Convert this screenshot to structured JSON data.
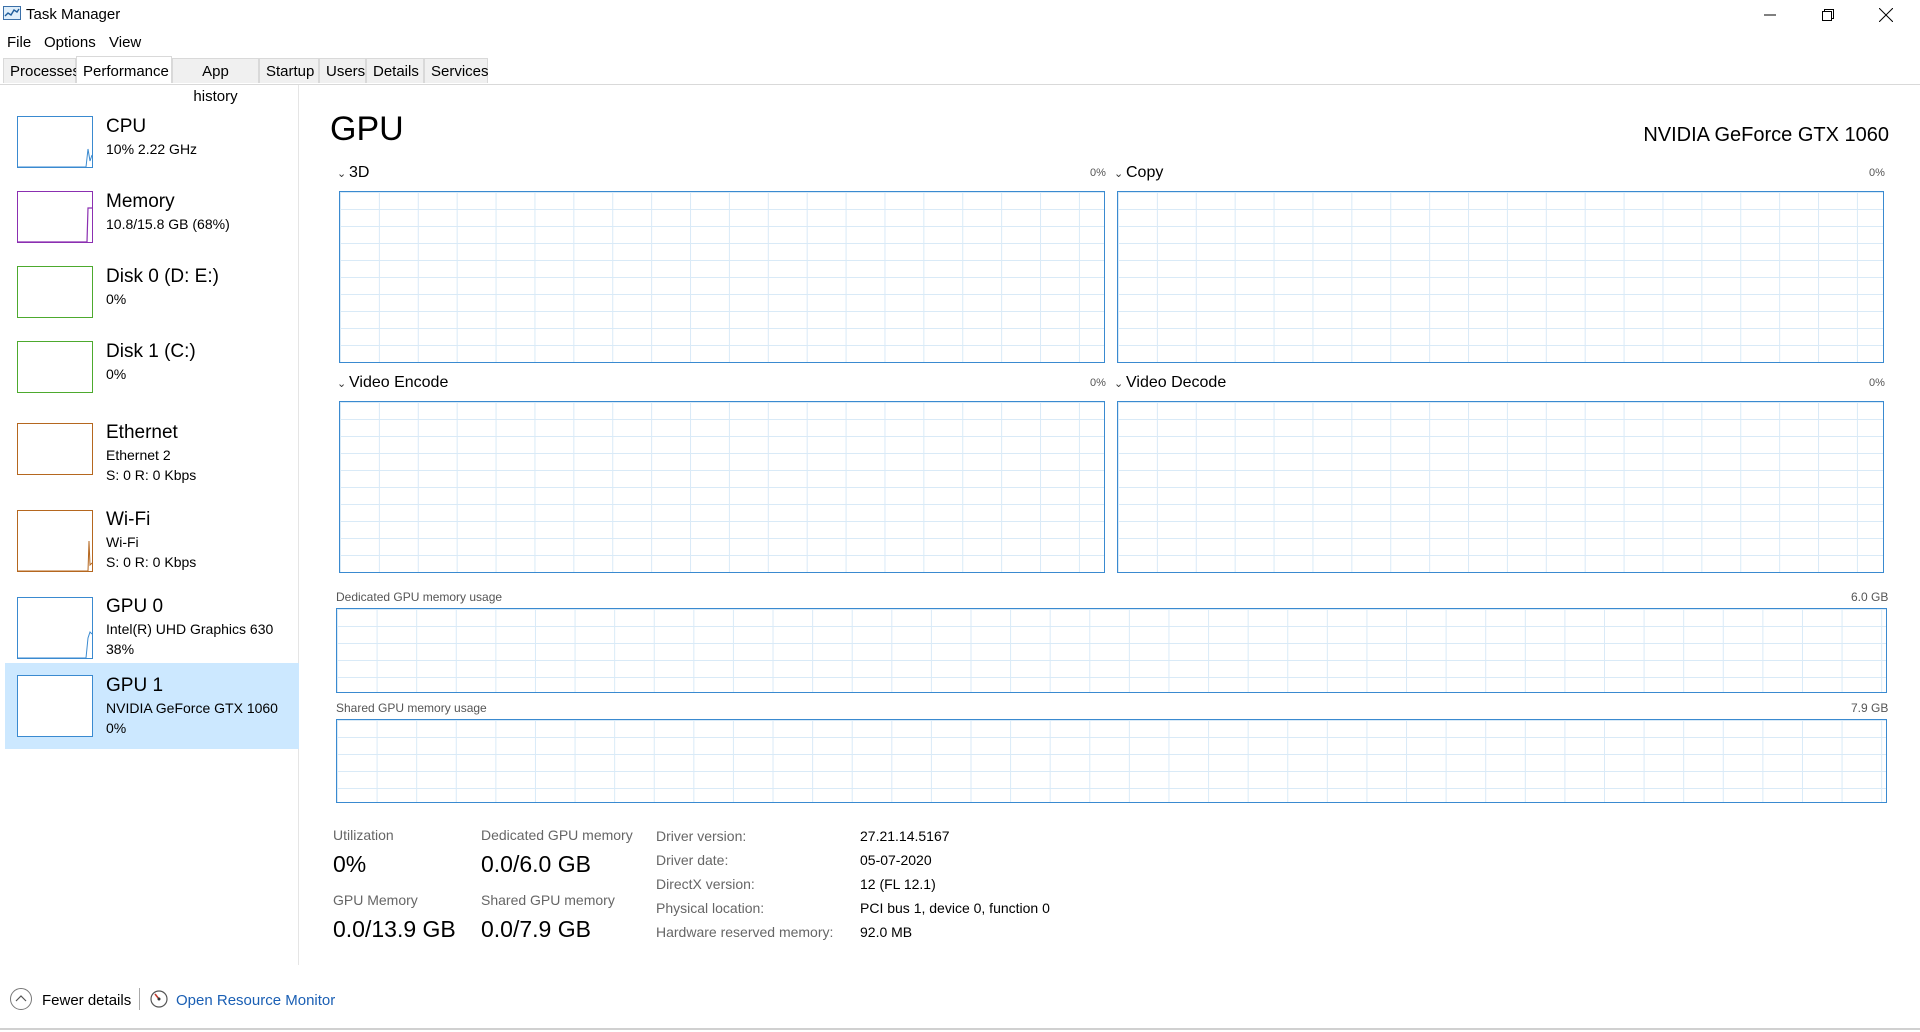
{
  "window": {
    "title": "Task Manager"
  },
  "menu": [
    "File",
    "Options",
    "View"
  ],
  "tabs": [
    "Processes",
    "Performance",
    "App history",
    "Startup",
    "Users",
    "Details",
    "Services"
  ],
  "active_tab": "Performance",
  "sidebar": {
    "items": [
      {
        "title": "CPU",
        "line2": "10%  2.22 GHz",
        "line3": "",
        "color": "#3a8ad0",
        "level": 0.1
      },
      {
        "title": "Memory",
        "line2": "10.8/15.8 GB (68%)",
        "line3": "",
        "color": "#8b2fb1",
        "level": 0.68
      },
      {
        "title": "Disk 0 (D: E:)",
        "line2": "0%",
        "line3": "",
        "color": "#4daa2e",
        "level": 0.0
      },
      {
        "title": "Disk 1 (C:)",
        "line2": "0%",
        "line3": "",
        "color": "#4daa2e",
        "level": 0.0
      },
      {
        "title": "Ethernet",
        "line2": "Ethernet 2",
        "line3": "S: 0  R: 0 Kbps",
        "color": "#b5671f",
        "level": 0.0
      },
      {
        "title": "Wi-Fi",
        "line2": "Wi-Fi",
        "line3": "S: 0  R: 0 Kbps",
        "color": "#b5671f",
        "level": 0.0
      },
      {
        "title": "GPU 0",
        "line2": "Intel(R) UHD Graphics 630",
        "line3": "38%",
        "color": "#3a8ad0",
        "level": 0.38
      },
      {
        "title": "GPU 1",
        "line2": "NVIDIA GeForce GTX 1060",
        "line3": "0%",
        "color": "#3a8ad0",
        "level": 0.0
      }
    ],
    "selected_index": 7
  },
  "main": {
    "title": "GPU",
    "device": "NVIDIA GeForce GTX 1060",
    "engines": [
      {
        "label": "3D",
        "pct": "0%"
      },
      {
        "label": "Copy",
        "pct": "0%"
      },
      {
        "label": "Video Encode",
        "pct": "0%"
      },
      {
        "label": "Video Decode",
        "pct": "0%"
      }
    ],
    "dedicated": {
      "label": "Dedicated GPU memory usage",
      "max": "6.0 GB"
    },
    "shared": {
      "label": "Shared GPU memory usage",
      "max": "7.9 GB"
    }
  },
  "stats": {
    "utilization": {
      "label": "Utilization",
      "value": "0%"
    },
    "dedicated_memory": {
      "label": "Dedicated GPU memory",
      "value": "0.0/6.0 GB"
    },
    "gpu_memory": {
      "label": "GPU Memory",
      "value": "0.0/13.9 GB"
    },
    "shared_memory": {
      "label": "Shared GPU memory",
      "value": "0.0/7.9 GB"
    }
  },
  "info": [
    {
      "label": "Driver version:",
      "value": "27.21.14.5167"
    },
    {
      "label": "Driver date:",
      "value": "05-07-2020"
    },
    {
      "label": "DirectX version:",
      "value": "12 (FL 12.1)"
    },
    {
      "label": "Physical location:",
      "value": "PCI bus 1, device 0, function 0"
    },
    {
      "label": "Hardware reserved memory:",
      "value": "92.0 MB"
    }
  ],
  "footer": {
    "fewer_details": "Fewer details",
    "open_resource_monitor": "Open Resource Monitor"
  },
  "colors": {
    "accent": "#3a8ad0",
    "selected_bg": "#cce8ff",
    "link": "#1a5fb4"
  }
}
